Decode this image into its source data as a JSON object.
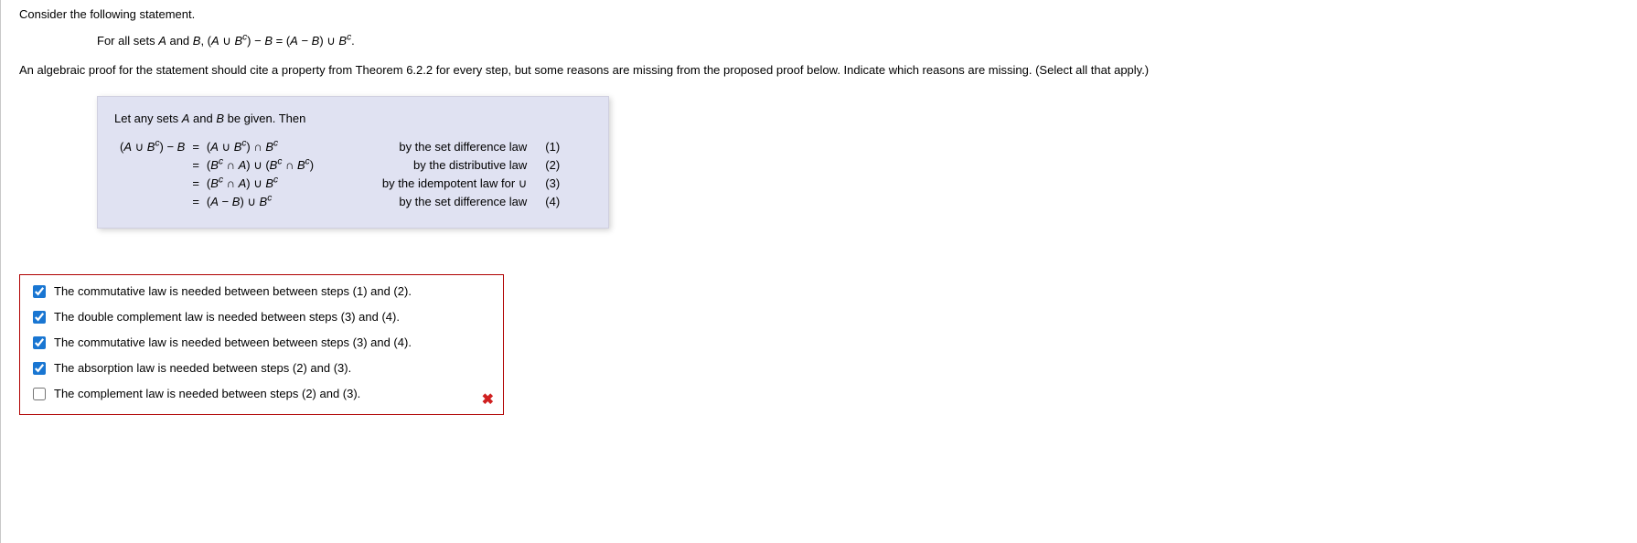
{
  "question_intro": "Consider the following statement.",
  "statement_prefix": "For all sets ",
  "statement_A": "A",
  "statement_and": " and ",
  "statement_B": "B",
  "statement_comma": ", (",
  "statement_expr": "A ∪ Bᶜ) − B = (A − B) ∪ Bᶜ.",
  "instruction": "An algebraic proof for the statement should cite a property from Theorem 6.2.2 for every step, but some reasons are missing from the proposed proof below. Indicate which reasons are missing. (Select all that apply.)",
  "proof_intro_prefix": "Let any sets ",
  "proof_intro_suffix": " be given. Then",
  "proof_rows": [
    {
      "lhs": "(A ∪ Bᶜ) − B",
      "rhs": "(A ∪ Bᶜ) ∩ Bᶜ",
      "reason": "by the set difference law",
      "tag": "(1)"
    },
    {
      "lhs": "",
      "rhs": "(Bᶜ ∩ A) ∪ (Bᶜ ∩ Bᶜ)",
      "reason": "by the distributive law",
      "tag": "(2)"
    },
    {
      "lhs": "",
      "rhs": "(Bᶜ ∩ A) ∪ Bᶜ",
      "reason": "by the idempotent law for ∪",
      "tag": "(3)"
    },
    {
      "lhs": "",
      "rhs": "(A − B) ∪ Bᶜ",
      "reason": "by the set difference law",
      "tag": "(4)"
    }
  ],
  "options": [
    {
      "label": "The commutative law is needed between between steps (1) and (2).",
      "checked": true
    },
    {
      "label": "The double complement law is needed between steps (3) and (4).",
      "checked": true
    },
    {
      "label": "The commutative law is needed between between steps (3) and (4).",
      "checked": true
    },
    {
      "label": "The absorption law is needed between steps (2) and (3).",
      "checked": true
    },
    {
      "label": "The complement law is needed between steps (2) and (3).",
      "checked": false
    }
  ],
  "feedback_icon": "✖"
}
